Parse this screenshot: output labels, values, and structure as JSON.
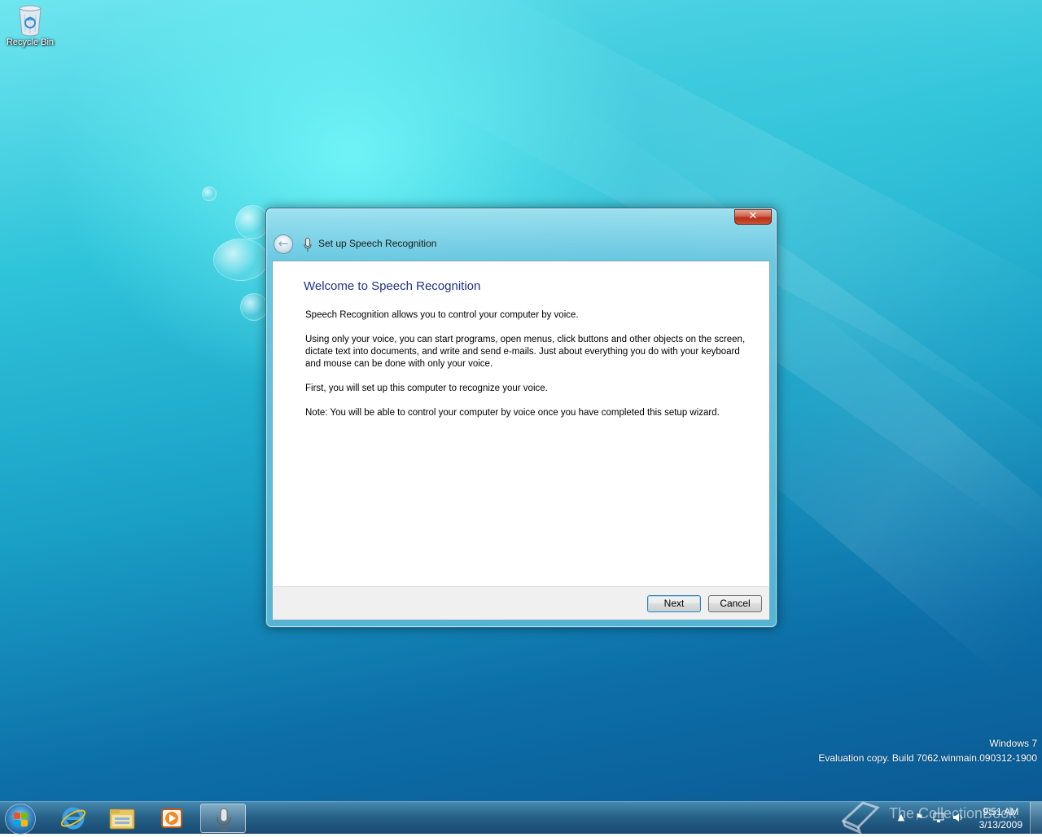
{
  "desktop": {
    "icons": [
      {
        "label": "Recycle Bin",
        "icon": "recycle-bin-icon"
      }
    ],
    "watermark": {
      "line1": "Windows 7",
      "line2": "Evaluation copy. Build 7062.winmain.090312-1900"
    },
    "overlay_text": "The CollectionBook"
  },
  "dialog": {
    "title": "Set up Speech Recognition",
    "back_icon": "back-arrow-icon",
    "title_icon": "microphone-icon",
    "close_label": "✕",
    "heading": "Welcome to Speech Recognition",
    "paragraphs": [
      "Speech Recognition allows you to control your computer by voice.",
      "Using only your voice, you can start programs, open menus, click buttons and other objects on the screen, dictate text into documents, and write and send e-mails. Just about everything you do with your keyboard and mouse can be done with only your voice.",
      "First, you will set up this computer to recognize your voice.",
      "Note: You will be able to control your computer by voice once you have completed this setup wizard."
    ],
    "buttons": {
      "next": "Next",
      "cancel": "Cancel"
    }
  },
  "taskbar": {
    "start_icon": "windows-start-icon",
    "pinned": [
      {
        "name": "Internet Explorer",
        "icon": "internet-explorer-icon"
      },
      {
        "name": "Windows Explorer",
        "icon": "folder-icon"
      },
      {
        "name": "Windows Media Player",
        "icon": "media-player-icon"
      },
      {
        "name": "Speech Recognition",
        "icon": "microphone-icon",
        "active": true
      }
    ],
    "tray": {
      "icons": [
        "show-hidden-icons-icon",
        "action-center-flag-icon",
        "network-icon",
        "volume-icon"
      ],
      "time": "9:51 AM",
      "date": "3/13/2009"
    }
  },
  "colors": {
    "heading": "#1e3287",
    "close_button": "#c8472b",
    "desktop_top": "#6fe6ef",
    "desktop_bottom": "#0b5a94"
  }
}
